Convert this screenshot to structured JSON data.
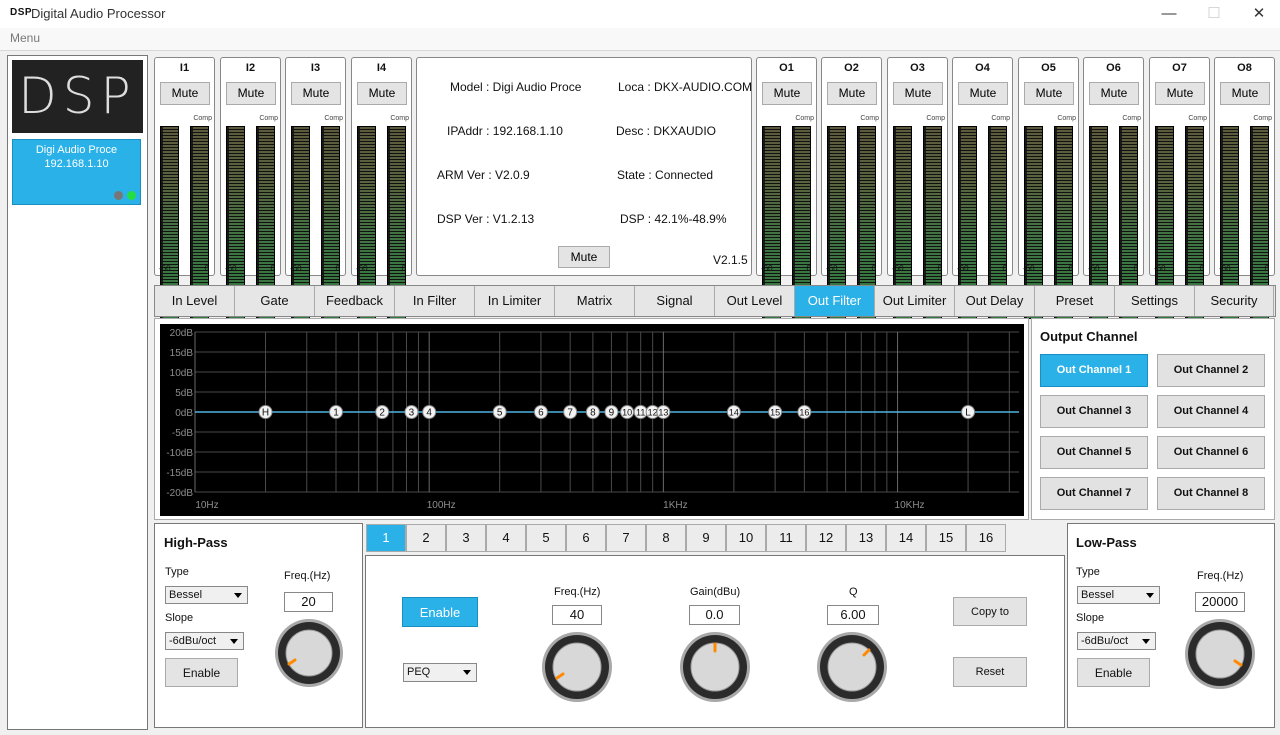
{
  "window": {
    "logo": "DSP",
    "title": "Digital Audio Processor",
    "minimize": "—",
    "maximize": "☐",
    "close": "✕"
  },
  "menu": {
    "label": "Menu"
  },
  "device": {
    "logo_text": "DSP",
    "name": "Digi Audio Proce",
    "ip": "192.168.1.10",
    "led_colors": [
      "#777777",
      "#22dd44"
    ]
  },
  "meters": {
    "comp_label": "Comp",
    "min_label": "-60",
    "max_label": "0",
    "mute_label": "Mute"
  },
  "inputs": [
    {
      "label": "I1"
    },
    {
      "label": "I2"
    },
    {
      "label": "I3"
    },
    {
      "label": "I4"
    }
  ],
  "outputs": [
    {
      "label": "O1"
    },
    {
      "label": "O2"
    },
    {
      "label": "O3"
    },
    {
      "label": "O4"
    },
    {
      "label": "O5"
    },
    {
      "label": "O6"
    },
    {
      "label": "O7"
    },
    {
      "label": "O8"
    }
  ],
  "info": {
    "model": "Model : Digi Audio Proce",
    "loca": "Loca : DKX-AUDIO.COM",
    "ipaddr": "IPAddr : 192.168.1.10",
    "desc": "Desc : DKXAUDIO",
    "arm": "ARM Ver : V2.0.9",
    "state": "State : Connected",
    "dspver": "DSP Ver : V1.2.13",
    "dspload": "DSP : 42.1%-48.9%",
    "mute_label": "Mute",
    "version": "V2.1.5"
  },
  "tabs": [
    {
      "label": "In Level"
    },
    {
      "label": "Gate"
    },
    {
      "label": "Feedback"
    },
    {
      "label": "In Filter"
    },
    {
      "label": "In Limiter"
    },
    {
      "label": "Matrix"
    },
    {
      "label": "Signal"
    },
    {
      "label": "Out Level"
    },
    {
      "label": "Out Filter"
    },
    {
      "label": "Out Limiter"
    },
    {
      "label": "Out Delay"
    },
    {
      "label": "Preset"
    },
    {
      "label": "Settings"
    },
    {
      "label": "Security"
    }
  ],
  "active_tab": "Out Filter",
  "graph": {
    "y_labels": [
      "20dB",
      "15dB",
      "10dB",
      "5dB",
      "0dB",
      "-5dB",
      "-10dB",
      "-15dB",
      "-20dB"
    ],
    "x_labels": [
      "10Hz",
      "100Hz",
      "1KHz",
      "10KHz"
    ],
    "curve_color": "#4fb4e0",
    "points": [
      {
        "label": "H",
        "freq": 20
      },
      {
        "label": "1",
        "freq": 40
      },
      {
        "label": "2",
        "freq": 63
      },
      {
        "label": "3",
        "freq": 84
      },
      {
        "label": "4",
        "freq": 100
      },
      {
        "label": "5",
        "freq": 200
      },
      {
        "label": "6",
        "freq": 300
      },
      {
        "label": "7",
        "freq": 400
      },
      {
        "label": "8",
        "freq": 500
      },
      {
        "label": "9",
        "freq": 600
      },
      {
        "label": "10",
        "freq": 700
      },
      {
        "label": "11",
        "freq": 800
      },
      {
        "label": "12",
        "freq": 900
      },
      {
        "label": "13",
        "freq": 1000
      },
      {
        "label": "14",
        "freq": 2000
      },
      {
        "label": "15",
        "freq": 3000
      },
      {
        "label": "16",
        "freq": 4000
      },
      {
        "label": "L",
        "freq": 20000
      }
    ]
  },
  "output_channel": {
    "title": "Output Channel",
    "channels": [
      {
        "label": "Out Channel 1"
      },
      {
        "label": "Out Channel 2"
      },
      {
        "label": "Out Channel 3"
      },
      {
        "label": "Out Channel 4"
      },
      {
        "label": "Out Channel 5"
      },
      {
        "label": "Out Channel 6"
      },
      {
        "label": "Out Channel 7"
      },
      {
        "label": "Out Channel 8"
      }
    ],
    "active": 1
  },
  "highpass": {
    "title": "High-Pass",
    "type_label": "Type",
    "type_value": "Bessel",
    "slope_label": "Slope",
    "slope_value": "-6dBu/oct",
    "enable_label": "Enable",
    "freq_label": "Freq.(Hz)",
    "freq_value": "20"
  },
  "lowpass": {
    "title": "Low-Pass",
    "type_label": "Type",
    "type_value": "Bessel",
    "slope_label": "Slope",
    "slope_value": "-6dBu/oct",
    "enable_label": "Enable",
    "freq_label": "Freq.(Hz)",
    "freq_value": "20000"
  },
  "bands": [
    "1",
    "2",
    "3",
    "4",
    "5",
    "6",
    "7",
    "8",
    "9",
    "10",
    "11",
    "12",
    "13",
    "14",
    "15",
    "16"
  ],
  "active_band": "1",
  "peq": {
    "enable_label": "Enable",
    "type_value": "PEQ",
    "freq_label": "Freq.(Hz)",
    "freq_value": "40",
    "gain_label": "Gain(dBu)",
    "gain_value": "0.0",
    "q_label": "Q",
    "q_value": "6.00",
    "copy_label": "Copy to",
    "reset_label": "Reset"
  },
  "accent_color": "#2ab1e8"
}
